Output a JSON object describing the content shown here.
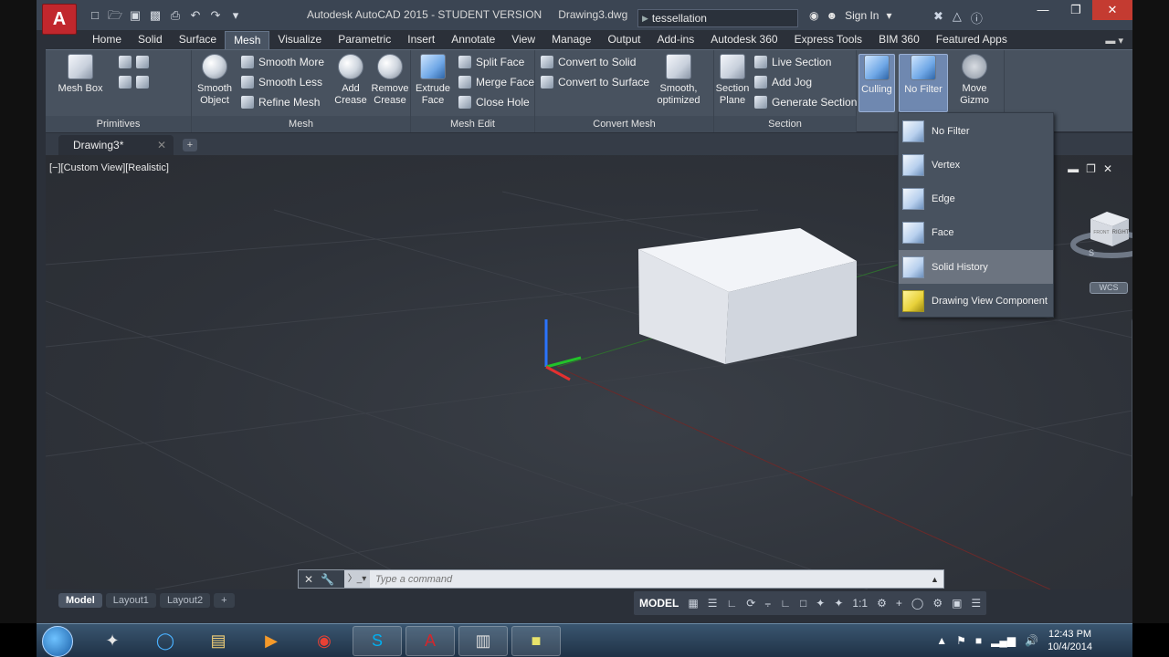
{
  "window": {
    "title": "Autodesk AutoCAD 2015 - STUDENT VERSION",
    "file": "Drawing3.dwg",
    "search_value": "tessellation",
    "sign_in": "Sign In"
  },
  "ribbon_tabs": [
    "Home",
    "Solid",
    "Surface",
    "Mesh",
    "Visualize",
    "Parametric",
    "Insert",
    "Annotate",
    "View",
    "Manage",
    "Output",
    "Add-ins",
    "Autodesk 360",
    "Express Tools",
    "BIM 360",
    "Featured Apps"
  ],
  "active_tab": "Mesh",
  "panels": {
    "primitives": {
      "title": "Primitives",
      "mesh_box": "Mesh Box"
    },
    "mesh": {
      "title": "Mesh",
      "smooth_object": "Smooth Object",
      "smooth_more": "Smooth More",
      "smooth_less": "Smooth Less",
      "refine_mesh": "Refine Mesh"
    },
    "mesh_edit": {
      "title": "Mesh Edit",
      "add_crease": "Add Crease",
      "remove_crease": "Remove Crease",
      "extrude_face": "Extrude Face",
      "split_face": "Split Face",
      "merge_face": "Merge Face",
      "close_hole": "Close Hole"
    },
    "convert_mesh": {
      "title": "Convert Mesh",
      "convert_to_solid": "Convert to Solid",
      "convert_to_surface": "Convert to Surface",
      "smooth_optimized": "Smooth, optimized"
    },
    "section": {
      "title": "Section",
      "section_plane": "Section Plane",
      "live_section": "Live Section",
      "add_jog": "Add Jog",
      "generate_section": "Generate Section"
    },
    "selection": {
      "culling": "Culling",
      "no_filter": "No Filter",
      "move_gizmo": "Move Gizmo"
    }
  },
  "doc_tab": "Drawing3*",
  "viewport": {
    "label": "[−][Custom View][Realistic]",
    "wcs": "WCS",
    "viewcube_face": "RIGHT",
    "viewcube_front": "FRONT",
    "compass_s": "S"
  },
  "filter_menu": [
    {
      "label": "No Filter",
      "icon": "no-filter-icon"
    },
    {
      "label": "Vertex",
      "icon": "vertex-icon"
    },
    {
      "label": "Edge",
      "icon": "edge-icon"
    },
    {
      "label": "Face",
      "icon": "face-icon"
    },
    {
      "label": "Solid History",
      "icon": "solid-history-icon"
    },
    {
      "label": "Drawing View Component",
      "icon": "drawing-view-component-icon"
    }
  ],
  "command_line": {
    "placeholder": "Type a command"
  },
  "layout_tabs": [
    "Model",
    "Layout1",
    "Layout2"
  ],
  "status": {
    "model": "MODEL",
    "scale": "1:1"
  },
  "clock": {
    "time": "12:43 PM",
    "date": "10/4/2014"
  },
  "colors": {
    "accent": "#c1272d",
    "ribbon": "#48525f",
    "viewport": "#2e3239"
  }
}
